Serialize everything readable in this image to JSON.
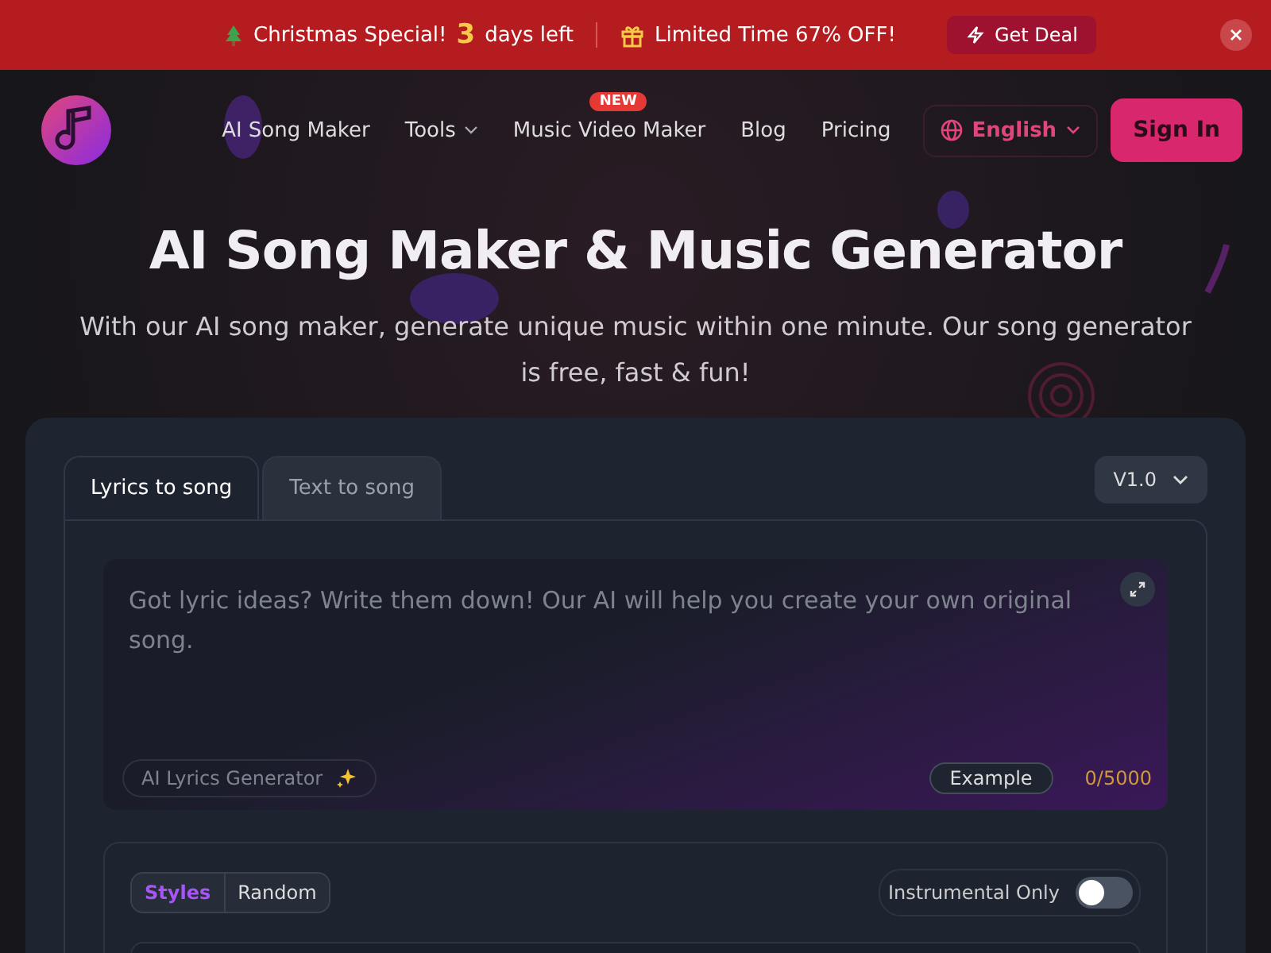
{
  "promo": {
    "items": [
      {
        "kind": "countdown",
        "label": "Christmas Special!",
        "count": "3",
        "suffix": "days left"
      },
      {
        "kind": "offer",
        "label": "Limited Time 67% OFF!"
      }
    ],
    "button": "Get Deal"
  },
  "nav": {
    "links": [
      {
        "label": "AI Song Maker",
        "dropdown": false
      },
      {
        "label": "Tools",
        "dropdown": true
      },
      {
        "label": "Music Video Maker",
        "dropdown": false,
        "badge": "NEW"
      },
      {
        "label": "Blog",
        "dropdown": false
      },
      {
        "label": "Pricing",
        "dropdown": false
      }
    ],
    "language": "English",
    "sign_in": "Sign In"
  },
  "hero": {
    "title": "AI Song Maker & Music Generator",
    "subtitle": "With our AI song maker, generate unique music within one minute. Our song generator is free, fast & fun!"
  },
  "tabs": [
    {
      "label": "Lyrics to song",
      "selected": true
    },
    {
      "label": "Text to song",
      "selected": false
    }
  ],
  "version": "V1.0",
  "lyrics": {
    "placeholder": "Got lyric ideas? Write them down! Our AI will help you create your own original song.",
    "helper": "AI Lyrics Generator",
    "example": "Example",
    "counter": "0/5000"
  },
  "styles": {
    "modes": [
      {
        "label": "Styles",
        "selected": true
      },
      {
        "label": "Random",
        "selected": false
      }
    ],
    "instrumental": {
      "label": "Instrumental Only",
      "on": false
    }
  }
}
